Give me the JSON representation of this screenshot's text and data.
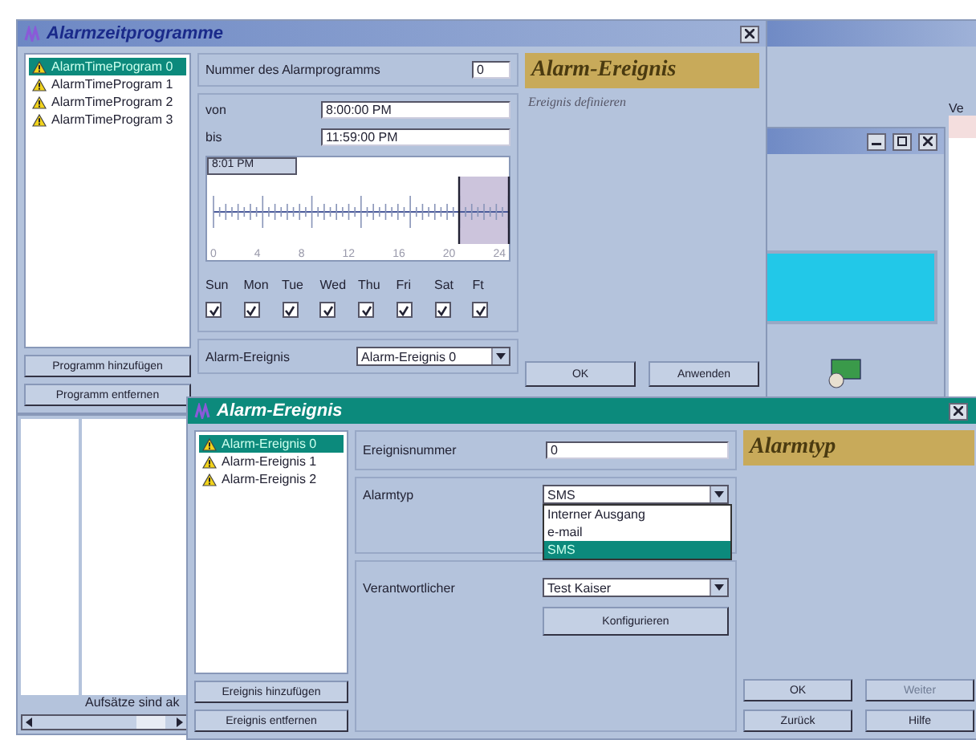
{
  "background_window": {
    "tab_label": "Ve"
  },
  "program_window": {
    "title": "Alarmzeitprogramme",
    "programs": [
      {
        "label": "AlarmTimeProgram 0",
        "selected": true
      },
      {
        "label": "AlarmTimeProgram 1",
        "selected": false
      },
      {
        "label": "AlarmTimeProgram 2",
        "selected": false
      },
      {
        "label": "AlarmTimeProgram 3",
        "selected": false
      }
    ],
    "list_buttons": [
      "Programm hinzufügen",
      "Programm entfernen"
    ],
    "number_label": "Nummer des Alarmprogramms",
    "number_value": "0",
    "from_label": "von",
    "from_value": "8:00:00 PM",
    "to_label": "bis",
    "to_value": "11:59:00 PM",
    "timeline": {
      "cursor_label": "8:01 PM",
      "ticks": [
        "0",
        "4",
        "8",
        "12",
        "16",
        "20",
        "24"
      ]
    },
    "days": [
      {
        "label": "Sun",
        "checked": true
      },
      {
        "label": "Mon",
        "checked": true
      },
      {
        "label": "Tue",
        "checked": true
      },
      {
        "label": "Wed",
        "checked": true
      },
      {
        "label": "Thu",
        "checked": true
      },
      {
        "label": "Fri",
        "checked": true
      },
      {
        "label": "Sat",
        "checked": true
      },
      {
        "label": "Ft",
        "checked": true
      }
    ],
    "event_label": "Alarm-Ereignis",
    "event_value": "Alarm-Ereignis 0",
    "heading": "Alarm-Ereignis",
    "subheading": "Ereignis definieren",
    "buttons": [
      "OK",
      "Anwenden"
    ]
  },
  "behind_window": {
    "status_text": "Aufsätze sind ak"
  },
  "event_window": {
    "title": "Alarm-Ereignis",
    "events": [
      {
        "label": "Alarm-Ereignis 0",
        "selected": true
      },
      {
        "label": "Alarm-Ereignis 1",
        "selected": false
      },
      {
        "label": "Alarm-Ereignis 2",
        "selected": false
      }
    ],
    "list_buttons": [
      "Ereignis hinzufügen",
      "Ereignis entfernen"
    ],
    "number_label": "Ereignisnummer",
    "number_value": "0",
    "type_label": "Alarmtyp",
    "type_value": "SMS",
    "type_options": [
      {
        "label": "Interner Ausgang",
        "selected": false
      },
      {
        "label": "e-mail",
        "selected": false
      },
      {
        "label": "SMS",
        "selected": true
      }
    ],
    "responsible_label": "Verantwortlicher",
    "responsible_value": "Test Kaiser",
    "configure_button": "Konfigurieren",
    "heading": "Alarmtyp",
    "buttons": [
      {
        "label": "OK",
        "disabled": false
      },
      {
        "label": "Weiter",
        "disabled": true
      },
      {
        "label": "Zurück",
        "disabled": false
      },
      {
        "label": "Hilfe",
        "disabled": false
      }
    ]
  }
}
